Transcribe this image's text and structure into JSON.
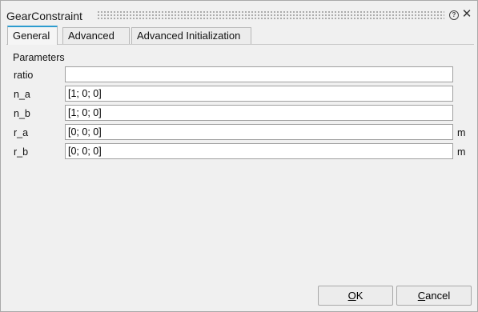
{
  "window": {
    "title": "GearConstraint",
    "help_icon": "help-icon",
    "close_icon": "close-icon"
  },
  "tabs": [
    {
      "label": "General",
      "active": true
    },
    {
      "label": "Advanced",
      "active": false
    },
    {
      "label": "Advanced Initialization",
      "active": false
    }
  ],
  "parameters": {
    "section_label": "Parameters",
    "rows": [
      {
        "label": "ratio",
        "value": "",
        "unit": ""
      },
      {
        "label": "n_a",
        "value": "[1; 0; 0]",
        "unit": ""
      },
      {
        "label": "n_b",
        "value": "[1; 0; 0]",
        "unit": ""
      },
      {
        "label": "r_a",
        "value": "[0; 0; 0]",
        "unit": "m"
      },
      {
        "label": "r_b",
        "value": "[0; 0; 0]",
        "unit": "m"
      }
    ]
  },
  "buttons": {
    "ok_label": "OK",
    "ok_mnemonic": "O",
    "ok_rest": "K",
    "cancel_label": "Cancel",
    "cancel_mnemonic": "C",
    "cancel_rest": "ancel"
  },
  "colors": {
    "active_tab_accent": "#2d9ccf",
    "background": "#f0f0f0"
  }
}
